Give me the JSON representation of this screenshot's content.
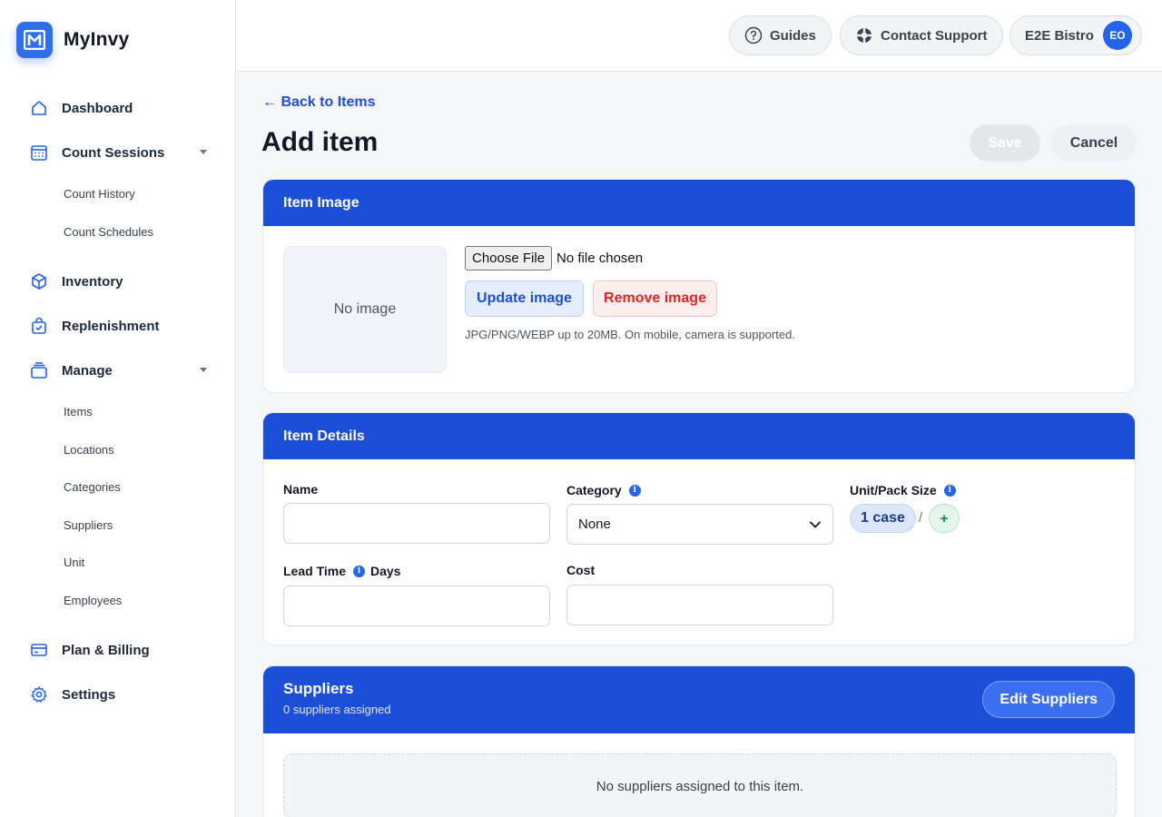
{
  "app": {
    "name": "MyInvy"
  },
  "sidebar": {
    "items": [
      {
        "label": "Dashboard"
      },
      {
        "label": "Count Sessions"
      },
      {
        "label": "Inventory"
      },
      {
        "label": "Replenishment"
      },
      {
        "label": "Manage"
      },
      {
        "label": "Plan & Billing"
      },
      {
        "label": "Settings"
      }
    ],
    "count_sessions_sub": [
      "Count History",
      "Count Schedules"
    ],
    "manage_sub": [
      "Items",
      "Locations",
      "Categories",
      "Suppliers",
      "Unit",
      "Employees"
    ]
  },
  "topbar": {
    "guides_label": "Guides",
    "support_label": "Contact Support",
    "workspace_label": "E2E Bistro",
    "avatar_initials": "EO"
  },
  "page": {
    "back_label": "← Back to Items",
    "title": "Add item",
    "save_label": "Save",
    "cancel_label": "Cancel"
  },
  "item_image": {
    "heading": "Item Image",
    "placeholder": "No image",
    "choose_file_label": "Choose File",
    "file_status": "No file chosen",
    "update_label": "Update image",
    "remove_label": "Remove image",
    "hint": "JPG/PNG/WEBP up to 20MB. On mobile, camera is supported."
  },
  "item_details": {
    "heading": "Item Details",
    "name_label": "Name",
    "name_value": "",
    "category_label": "Category",
    "category_value": "None",
    "unit_label": "Unit/Pack Size",
    "unit_chip": "1 case",
    "unit_slash": "/",
    "unit_add": "+",
    "lead_time_label": "Lead Time",
    "lead_time_unit": "Days",
    "lead_time_value": "",
    "cost_label": "Cost",
    "cost_value": "",
    "info_glyph": "i"
  },
  "suppliers": {
    "heading": "Suppliers",
    "count_text": "0 suppliers assigned",
    "edit_label": "Edit Suppliers",
    "empty_text": "No suppliers assigned to this item."
  },
  "colors": {
    "accent": "#1d4ed8",
    "brand": "#2f6fe8",
    "danger": "#dc2626",
    "success": "#15803d"
  }
}
